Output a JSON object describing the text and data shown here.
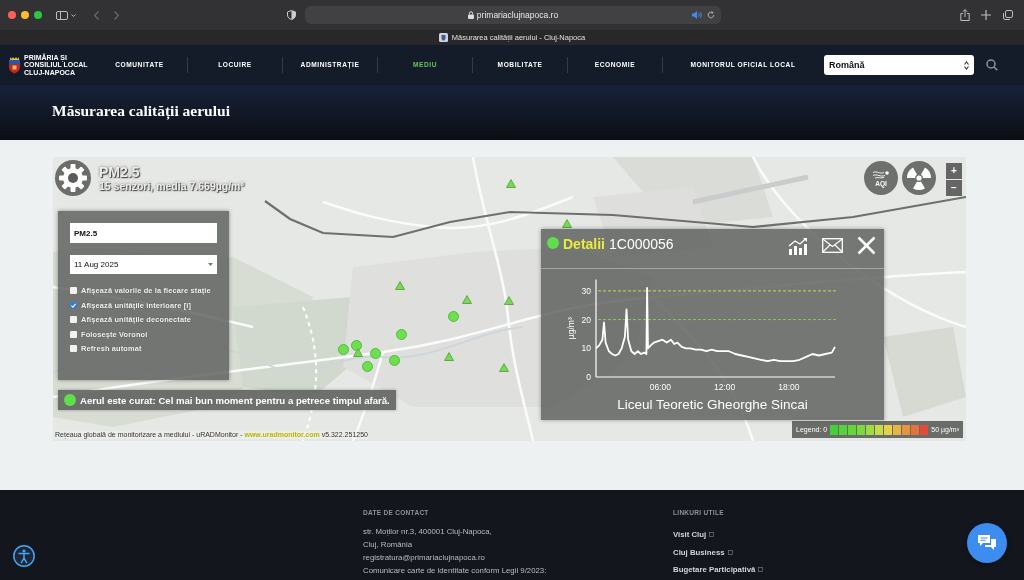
{
  "browser": {
    "url": "primariaclujnapoca.ro",
    "tab_title": "Măsurarea calității aerului - Cluj-Napoca"
  },
  "nav": {
    "logo_lines": [
      "PRIMĂRIA ȘI",
      "CONSILIUL LOCAL",
      "CLUJ-NAPOCA"
    ],
    "items": [
      {
        "label": "COMUNITATE",
        "selected": false
      },
      {
        "label": "LOCUIRE",
        "selected": false
      },
      {
        "label": "ADMINISTRAȚIE",
        "selected": false
      },
      {
        "label": "MEDIU",
        "selected": true
      },
      {
        "label": "MOBILITATE",
        "selected": false
      },
      {
        "label": "ECONOMIE",
        "selected": false
      },
      {
        "label": "MONITORUL OFICIAL LOCAL",
        "selected": false
      }
    ],
    "language": "Română"
  },
  "page_title": "Măsurarea calității aerului",
  "map": {
    "pollutant": "PM2.5",
    "summary": "15 senzori, media 7.669µg/m³",
    "controls": {
      "pollutant_field": "PM2.5",
      "date_field": "11 Aug 2025",
      "options": [
        {
          "label": "Afișează valorile de la fiecare stație",
          "checked": false
        },
        {
          "label": "Afișează unitățile interioare [i]",
          "checked": true
        },
        {
          "label": "Afișează unitățile deconectate",
          "checked": false
        },
        {
          "label": "Folosește Voronoi",
          "checked": false
        },
        {
          "label": "Refresh automat",
          "checked": false
        }
      ]
    },
    "status_message": "Aerul este curat: Cel mai bun moment pentru a petrece timpul afară.",
    "attribution": {
      "text": "Rețeaua globală de monitorizare a mediului - uRADMonitor -",
      "link": "www.uradmonitor.com",
      "version": "v5.322.251250"
    },
    "aqi_button": "AQI",
    "zoom_in": "+",
    "zoom_out": "−",
    "markers": [
      {
        "kind": "triangle"
      },
      {
        "kind": "triangle"
      },
      {
        "kind": "triangle"
      },
      {
        "kind": "triangle"
      },
      {
        "kind": "triangle"
      },
      {
        "kind": "dot"
      },
      {
        "kind": "dot"
      },
      {
        "kind": "dot"
      },
      {
        "kind": "dot"
      },
      {
        "kind": "triangle"
      },
      {
        "kind": "dot"
      },
      {
        "kind": "triangle"
      },
      {
        "kind": "dot"
      },
      {
        "kind": "dot"
      },
      {
        "kind": "triangle"
      }
    ],
    "details": {
      "heading": "Detalii",
      "sensor_id": "1C000056",
      "station": "Liceul Teoretic Gheorghe Sincai",
      "chart_data": {
        "type": "line",
        "ylabel": "µg/m³",
        "x": [
          0,
          0.3,
          0.6,
          0.75,
          0.9,
          1.2,
          1.5,
          1.8,
          2.1,
          2.4,
          2.7,
          2.85,
          3.0,
          3.3,
          3.6,
          3.9,
          4.2,
          4.5,
          4.7,
          4.77,
          4.85,
          5.1,
          5.4,
          5.8,
          6.2,
          6.6,
          7.0,
          7.3,
          7.6,
          8.0,
          8.4,
          8.8,
          9.3,
          9.8,
          10.3,
          10.8,
          11.3,
          11.8,
          12.4,
          13.0,
          13.6,
          14.2,
          14.8,
          15.4,
          16.0,
          16.6,
          17.2,
          17.8,
          18.4,
          19.0,
          19.6,
          20.2,
          20.8,
          21.4,
          22.0,
          22.3
        ],
        "series": [
          {
            "color": "#ffffff",
            "values": [
              10,
              11,
              13,
              19,
              12,
              9,
              8,
              7.5,
              8,
              10,
              14,
              23.5,
              13,
              9,
              8,
              9,
              8,
              8.5,
              8,
              31,
              10,
              11,
              12,
              12.5,
              13,
              12,
              13,
              11.5,
              12,
              10.5,
              10,
              10,
              9.5,
              9.5,
              9,
              9.5,
              9,
              9,
              9,
              8,
              7.5,
              7,
              6.5,
              6,
              5.5,
              6,
              5.5,
              5.5,
              5.5,
              6,
              7,
              8,
              7.5,
              8,
              8.5,
              10.5
            ]
          }
        ],
        "xlim": [
          0,
          22.3
        ],
        "ylim": [
          0,
          34
        ],
        "xticks": [
          {
            "value": 6,
            "label": "06:00"
          },
          {
            "value": 12,
            "label": "12:00"
          },
          {
            "value": 18,
            "label": "18:00"
          }
        ],
        "yticks": [
          0,
          10,
          20,
          30
        ],
        "ref_lines": [
          {
            "axis": "y",
            "value": 30,
            "color": "#d2d24c"
          },
          {
            "axis": "y",
            "value": 20,
            "color": "#86cf4c"
          }
        ]
      }
    },
    "legend": {
      "min_label": "Legend: 0",
      "max_label": "50 µg/m³",
      "swatches": [
        {
          "color": "#44d038"
        },
        {
          "color": "#52d43a"
        },
        {
          "color": "#62d63c"
        },
        {
          "color": "#7cd840"
        },
        {
          "color": "#a0da44"
        },
        {
          "color": "#c8dc48"
        },
        {
          "color": "#e4d24a"
        },
        {
          "color": "#e8b446"
        },
        {
          "color": "#e69442"
        },
        {
          "color": "#e4723e"
        },
        {
          "color": "#e04a38"
        }
      ]
    }
  },
  "footer": {
    "contact": {
      "heading": "DATE DE CONTACT",
      "lines": [
        "str. Moților nr.3, 400001 Cluj-Napoca,",
        "Cluj, România",
        "registratura@primariaclujnapoca.ro",
        "Comunicare carte de identitate conform Legii 9/2023:"
      ]
    },
    "links": {
      "heading": "LINKURI UTILE",
      "items": [
        "Visit Cluj",
        "Cluj Business",
        "Bugetare Participativă"
      ]
    }
  }
}
